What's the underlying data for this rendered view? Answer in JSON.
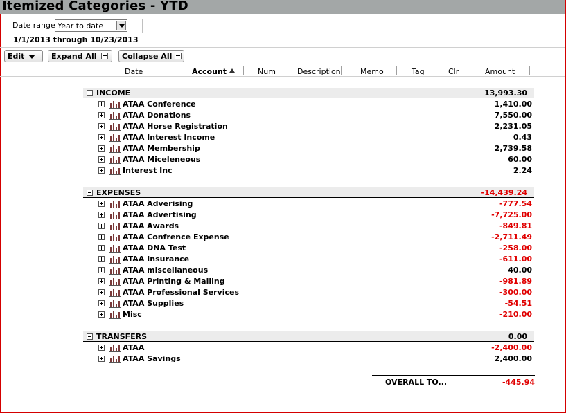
{
  "window": {
    "title": "Itemized Categories - YTD"
  },
  "filter": {
    "date_range_label": "Date range:",
    "date_range_value": "Year to date",
    "range_text": "1/1/2013 through 10/23/2013"
  },
  "toolbar": {
    "edit_label": "Edit",
    "expand_all_label": "Expand All",
    "collapse_all_label": "Collapse All"
  },
  "columns": [
    "Date",
    "Account",
    "Num",
    "Description",
    "Memo",
    "Tag",
    "Clr",
    "Amount"
  ],
  "sort_column": "Account",
  "sections": [
    {
      "name": "INCOME",
      "total": "13,993.30",
      "total_negative": false,
      "rows": [
        {
          "name": "ATAA Conference",
          "amount": "1,410.00",
          "negative": false
        },
        {
          "name": "ATAA Donations",
          "amount": "7,550.00",
          "negative": false
        },
        {
          "name": "ATAA Horse Registration",
          "amount": "2,231.05",
          "negative": false
        },
        {
          "name": "ATAA Interest Income",
          "amount": "0.43",
          "negative": false
        },
        {
          "name": "ATAA Membership",
          "amount": "2,739.58",
          "negative": false
        },
        {
          "name": "ATAA Miceleneous",
          "amount": "60.00",
          "negative": false
        },
        {
          "name": "Interest Inc",
          "amount": "2.24",
          "negative": false
        }
      ]
    },
    {
      "name": "EXPENSES",
      "total": "-14,439.24",
      "total_negative": true,
      "rows": [
        {
          "name": "ATAA Adverising",
          "amount": "-777.54",
          "negative": true
        },
        {
          "name": "ATAA Advertising",
          "amount": "-7,725.00",
          "negative": true
        },
        {
          "name": "ATAA Awards",
          "amount": "-849.81",
          "negative": true
        },
        {
          "name": "ATAA Confrence Expense",
          "amount": "-2,711.49",
          "negative": true
        },
        {
          "name": "ATAA DNA Test",
          "amount": "-258.00",
          "negative": true
        },
        {
          "name": "ATAA Insurance",
          "amount": "-611.00",
          "negative": true
        },
        {
          "name": "ATAA miscellaneous",
          "amount": "40.00",
          "negative": false
        },
        {
          "name": "ATAA Printing & Mailing",
          "amount": "-981.89",
          "negative": true
        },
        {
          "name": "ATAA Professional Services",
          "amount": "-300.00",
          "negative": true
        },
        {
          "name": "ATAA Supplies",
          "amount": "-54.51",
          "negative": true
        },
        {
          "name": "Misc",
          "amount": "-210.00",
          "negative": true
        }
      ]
    },
    {
      "name": "TRANSFERS",
      "total": "0.00",
      "total_negative": false,
      "rows": [
        {
          "name": "ATAA",
          "amount": "-2,400.00",
          "negative": true
        },
        {
          "name": "ATAA Savings",
          "amount": "2,400.00",
          "negative": false
        }
      ]
    }
  ],
  "overall": {
    "label": "OVERALL TO...",
    "amount": "-445.94",
    "negative": true
  },
  "colors": {
    "negative": "#e00000",
    "title_bar": "#a3a7a7",
    "section_header": "#ececec",
    "frame_border": "#d40000"
  }
}
